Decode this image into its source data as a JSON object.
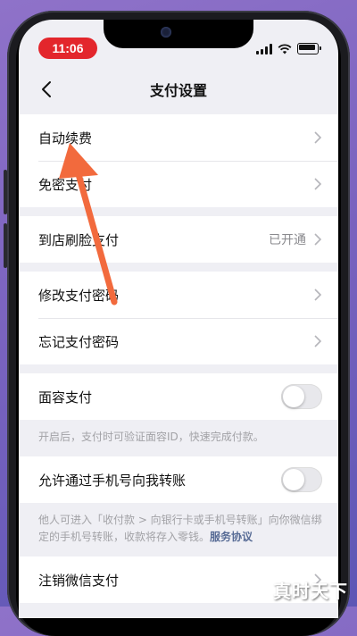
{
  "status_bar": {
    "time": "11:06"
  },
  "nav": {
    "title": "支付设置",
    "back_icon": "chevron-left-icon"
  },
  "groups": {
    "g1": [
      {
        "label": "自动续费"
      },
      {
        "label": "免密支付"
      }
    ],
    "g2": [
      {
        "label": "到店刷脸支付",
        "value": "已开通"
      }
    ],
    "g3": [
      {
        "label": "修改支付密码"
      },
      {
        "label": "忘记支付密码"
      }
    ],
    "face_pay": {
      "label": "面容支付",
      "enabled": false,
      "note": "开启后，支付时可验证面容ID，快速完成付款。"
    },
    "phone_transfer": {
      "label": "允许通过手机号向我转账",
      "enabled": false,
      "note": "他人可进入「收付款 > 向银行卡或手机号转账」向你微信绑定的手机号转账，收款将存入零钱。",
      "link": "服务协议"
    },
    "g4": [
      {
        "label": "注销微信支付"
      }
    ]
  },
  "annotation": {
    "arrow_color": "#f26a3d"
  },
  "watermark": "真时天下",
  "colors": {
    "time_pill": "#e3262c",
    "link": "#576b95",
    "background": "#efeff4"
  }
}
